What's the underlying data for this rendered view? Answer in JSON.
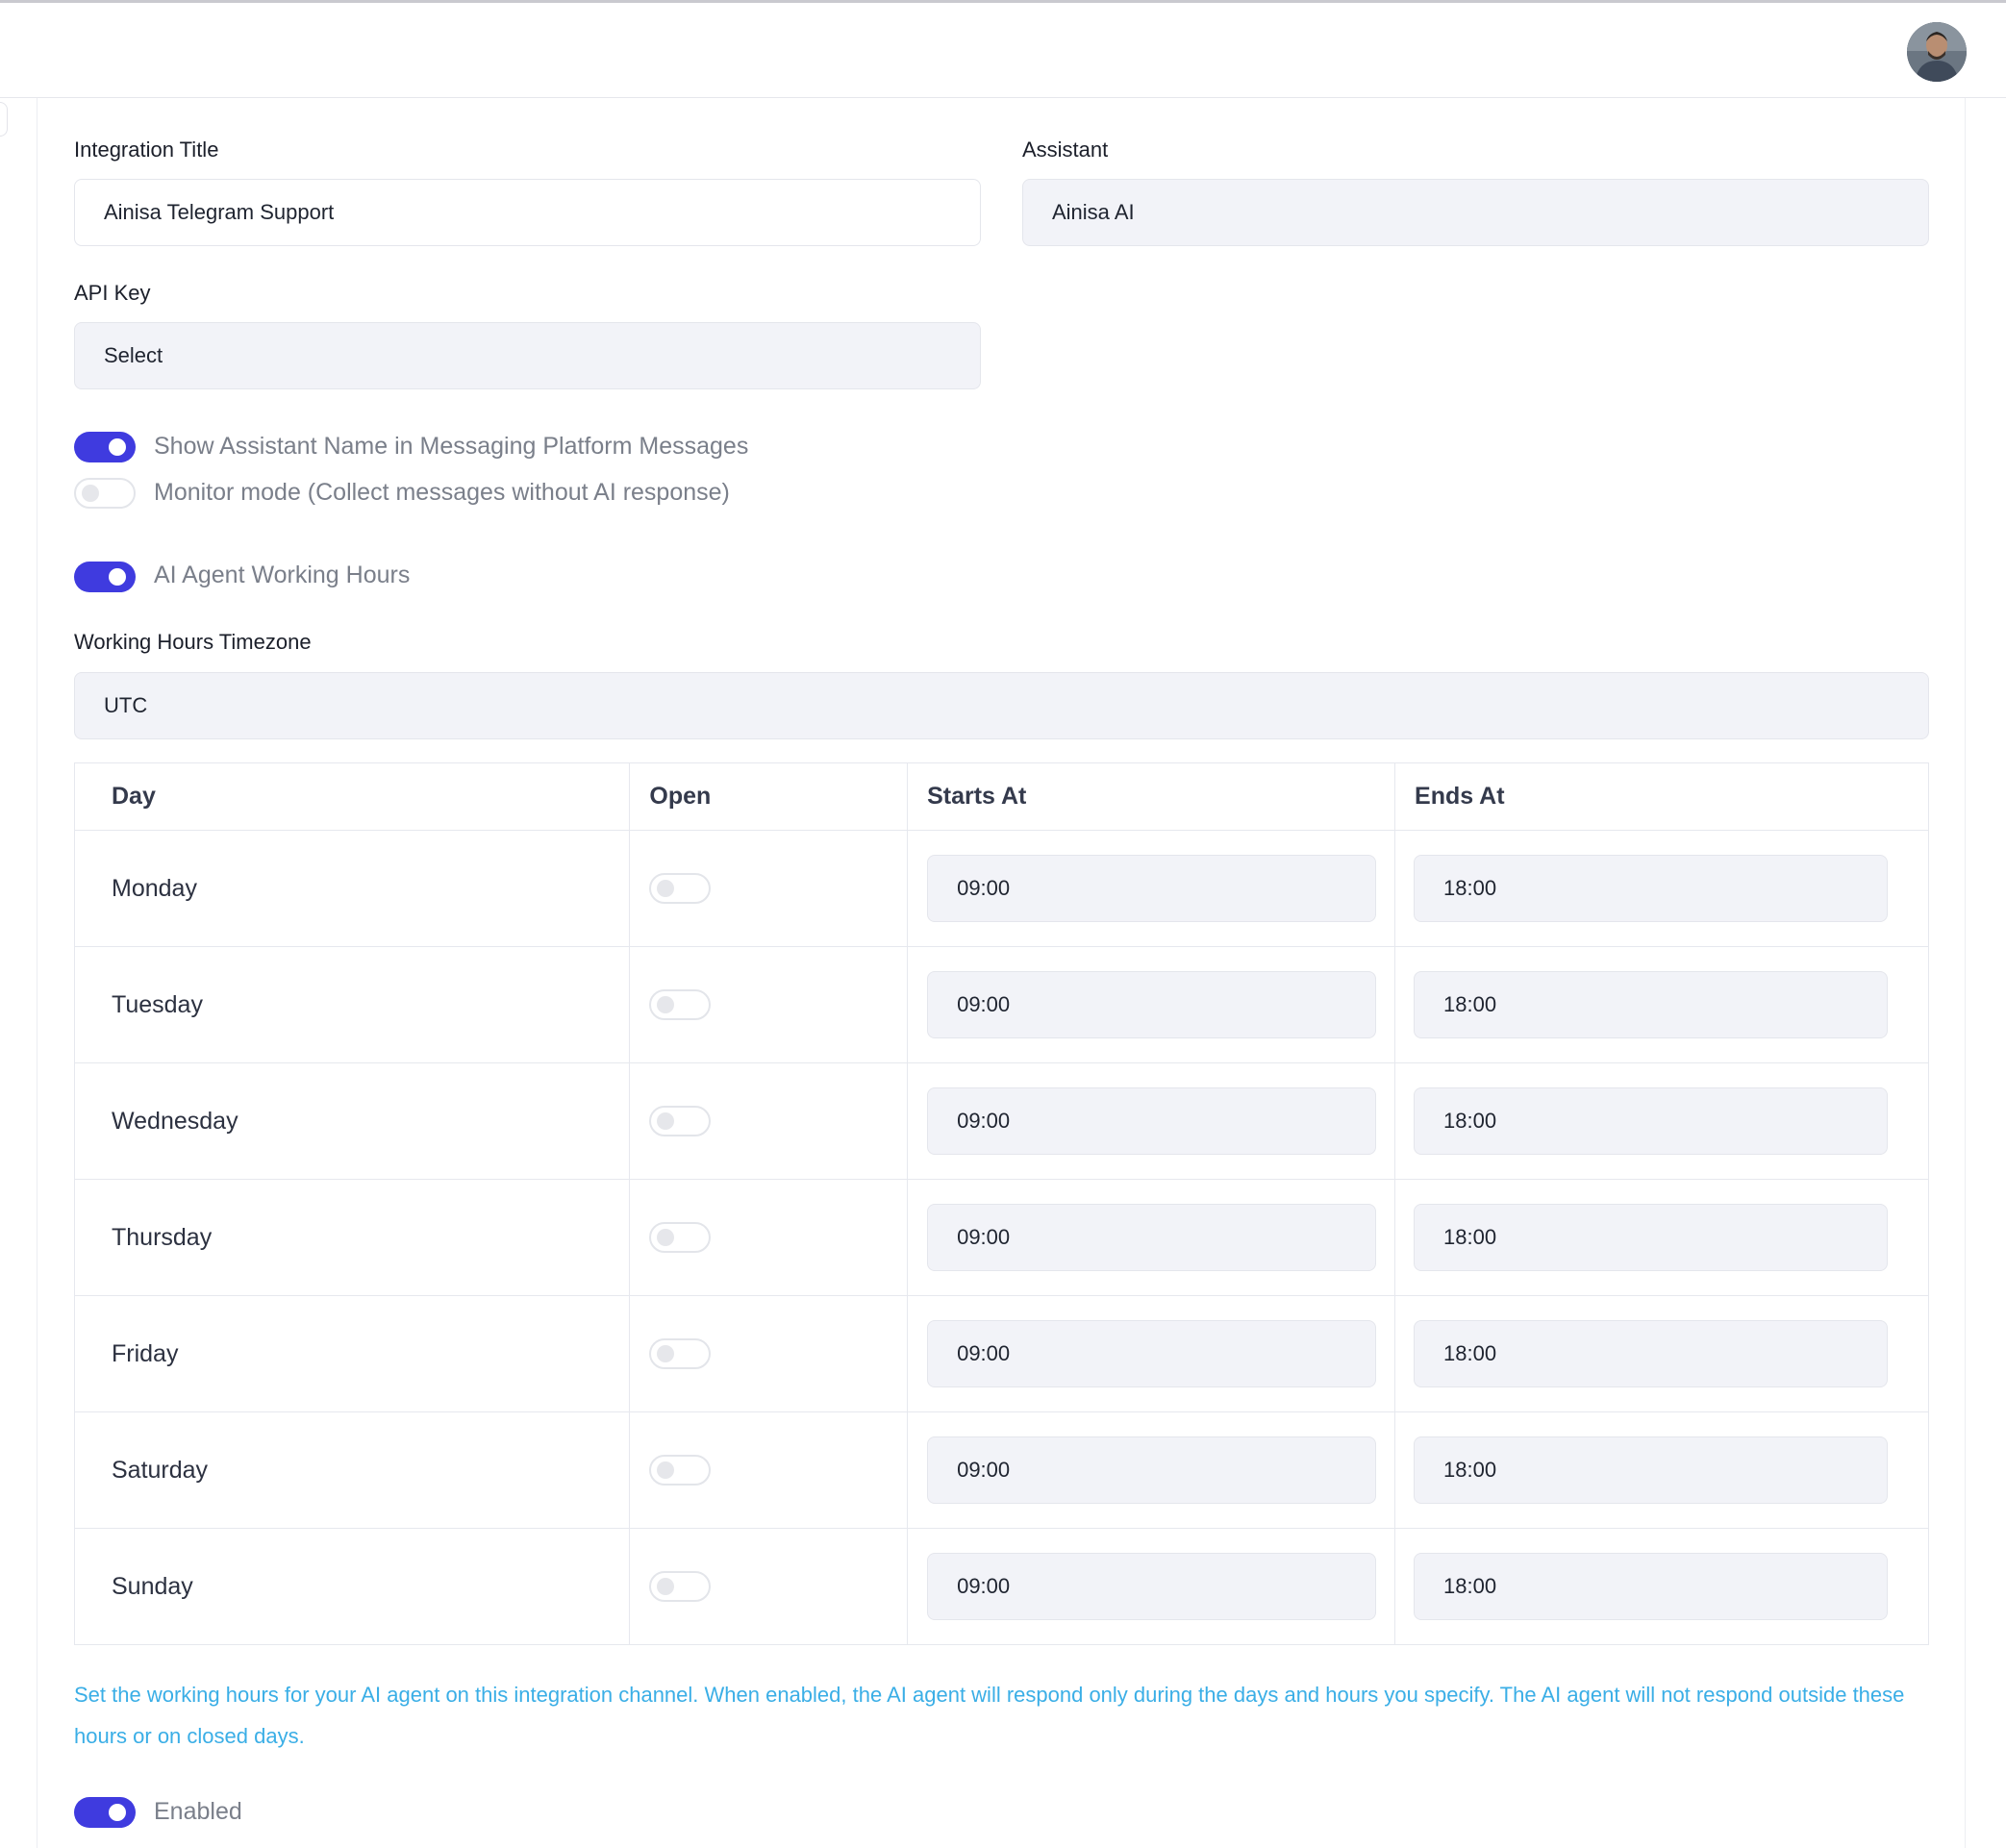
{
  "header": {
    "avatar_alt": "User avatar"
  },
  "form": {
    "integration_title": {
      "label": "Integration Title",
      "value": "Ainisa Telegram Support"
    },
    "assistant": {
      "label": "Assistant",
      "value": "Ainisa AI"
    },
    "api_key": {
      "label": "API Key",
      "value": "Select"
    },
    "toggles": {
      "show_assistant_name": {
        "label": "Show Assistant Name in Messaging Platform Messages",
        "enabled": true
      },
      "monitor_mode": {
        "label": "Monitor mode (Collect messages without AI response)",
        "enabled": false
      },
      "working_hours": {
        "label": "AI Agent Working Hours",
        "enabled": true
      }
    },
    "timezone": {
      "label": "Working Hours Timezone",
      "value": "UTC"
    }
  },
  "schedule": {
    "columns": {
      "day": "Day",
      "open": "Open",
      "starts": "Starts At",
      "ends": "Ends At"
    },
    "rows": [
      {
        "day": "Monday",
        "open": false,
        "starts": "09:00",
        "ends": "18:00"
      },
      {
        "day": "Tuesday",
        "open": false,
        "starts": "09:00",
        "ends": "18:00"
      },
      {
        "day": "Wednesday",
        "open": false,
        "starts": "09:00",
        "ends": "18:00"
      },
      {
        "day": "Thursday",
        "open": false,
        "starts": "09:00",
        "ends": "18:00"
      },
      {
        "day": "Friday",
        "open": false,
        "starts": "09:00",
        "ends": "18:00"
      },
      {
        "day": "Saturday",
        "open": false,
        "starts": "09:00",
        "ends": "18:00"
      },
      {
        "day": "Sunday",
        "open": false,
        "starts": "09:00",
        "ends": "18:00"
      }
    ],
    "help_text": "Set the working hours for your AI agent on this integration channel. When enabled, the AI agent will respond only during the days and hours you specify. The AI agent will not respond outside these hours or on closed days."
  },
  "enabled_toggle": {
    "label": "Enabled",
    "enabled": true
  },
  "colors": {
    "accent": "#3f3bdf",
    "help_text": "#3aaee6",
    "field_bg": "#f2f3f8"
  }
}
